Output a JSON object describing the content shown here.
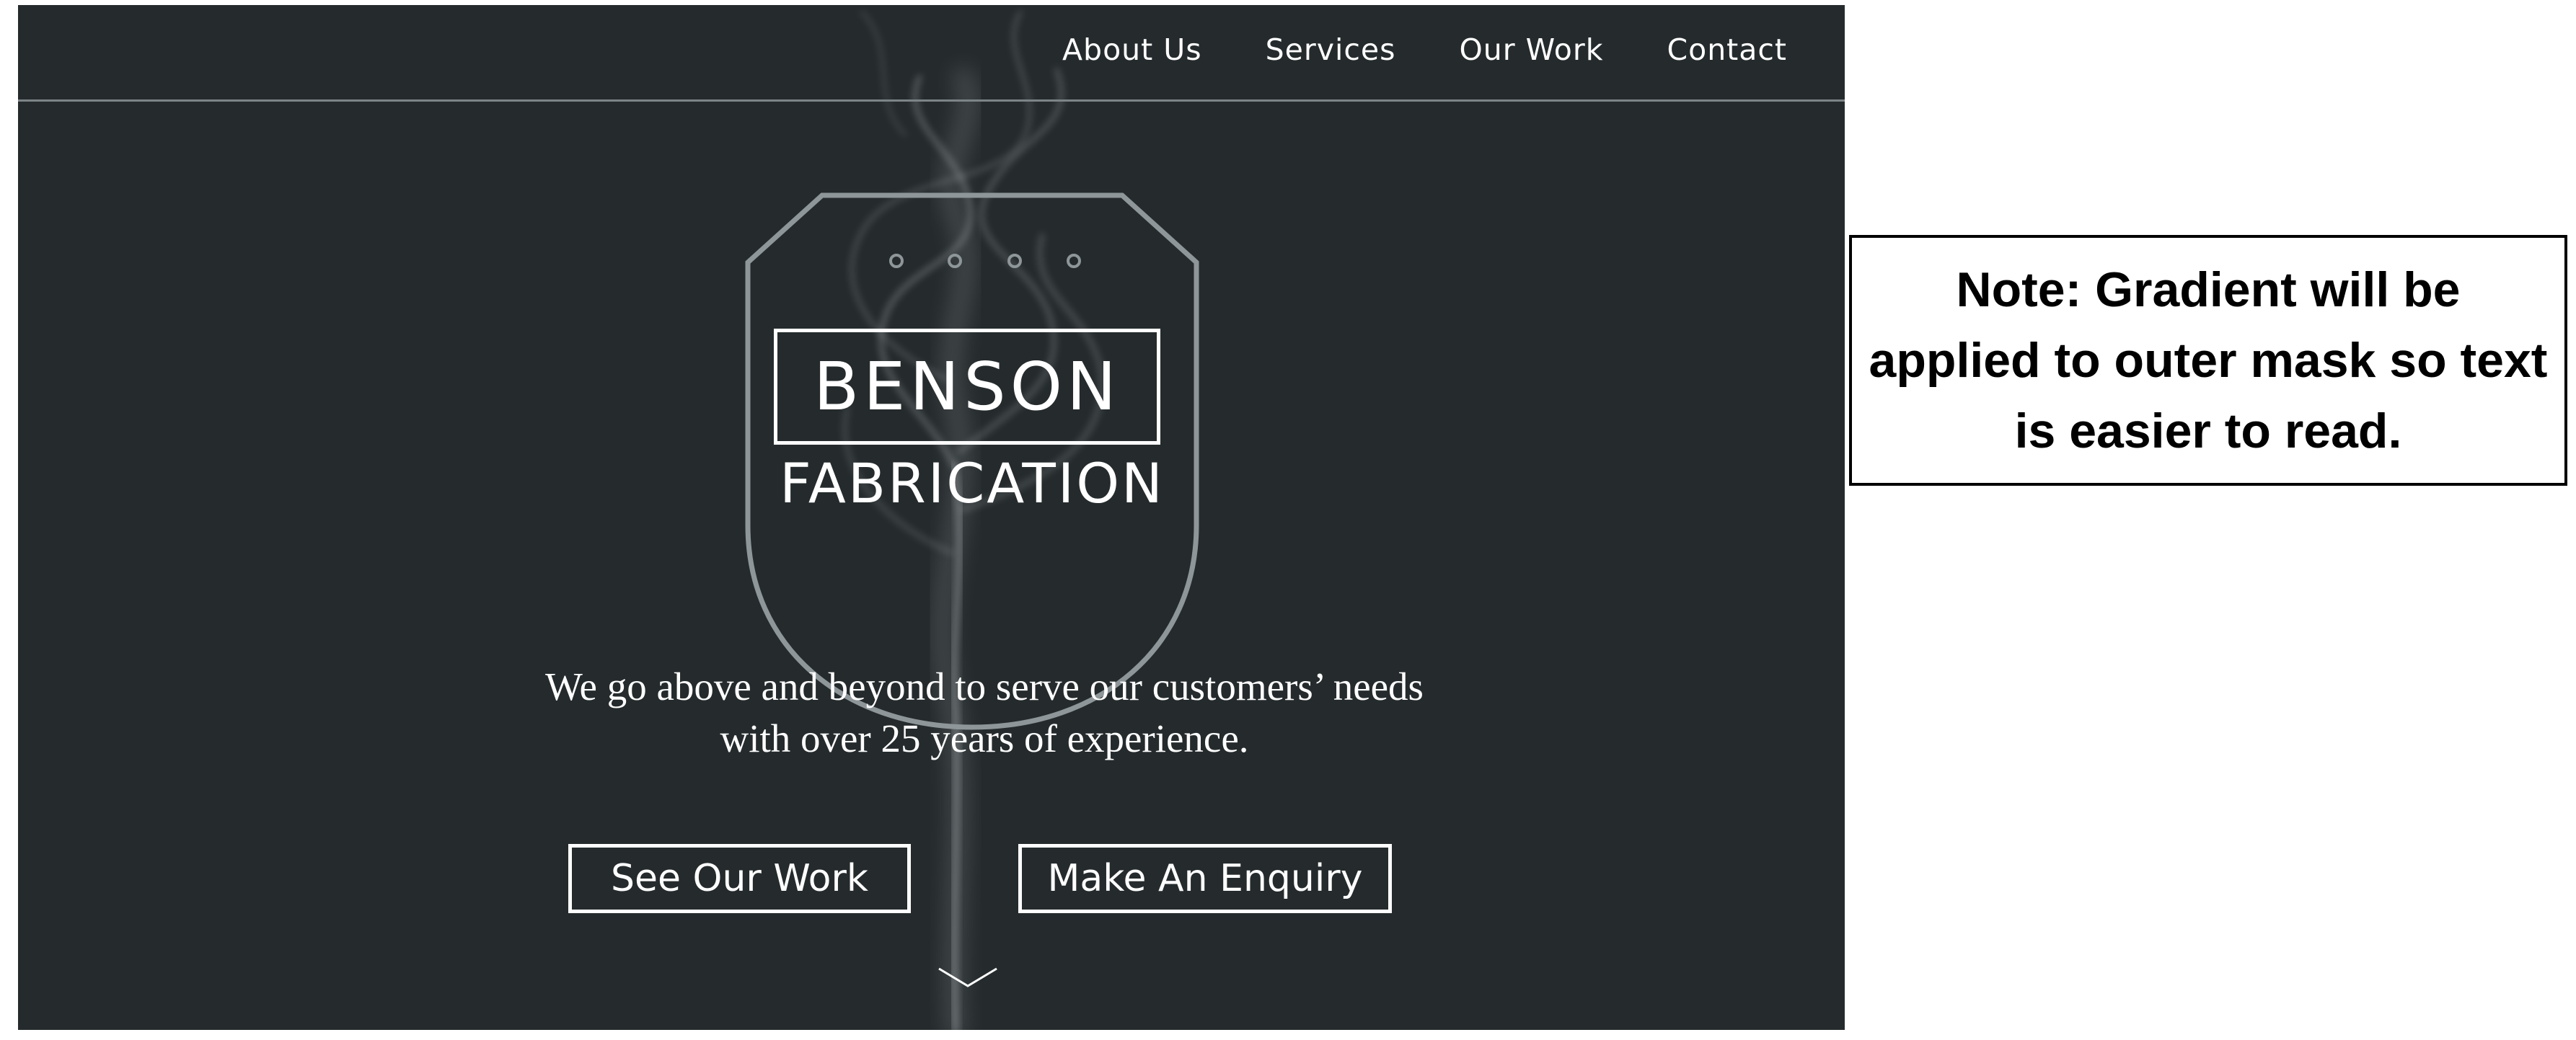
{
  "nav": {
    "items": [
      {
        "label": "About Us"
      },
      {
        "label": "Services"
      },
      {
        "label": "Our Work"
      },
      {
        "label": "Contact"
      }
    ]
  },
  "brand": {
    "name_main": "BENSON",
    "name_sub": "FABRICATION"
  },
  "hero": {
    "tagline_line1": "We go above and beyond to serve our customers’ needs",
    "tagline_line2": "with over 25 years of experience.",
    "cta_primary": "See Our Work",
    "cta_secondary": "Make An Enquiry",
    "background_color": "#252b2d",
    "scroll_icon": "chevron-down-icon"
  },
  "note": {
    "text": "Note: Gradient will be applied to outer mask so text is easier to read."
  }
}
